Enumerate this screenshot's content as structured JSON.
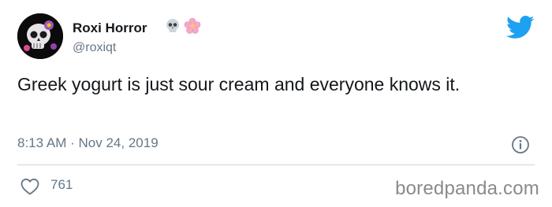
{
  "author": {
    "display_name": "Roxi Horror",
    "handle": "@roxiqt",
    "name_emojis": [
      "💀",
      "🌸"
    ]
  },
  "tweet": {
    "text": "Greek yogurt is just sour cream and everyone knows it.",
    "time": "8:13 AM",
    "separator": "·",
    "date": "Nov 24, 2019",
    "likes": "761"
  },
  "watermark": "boredpanda.com",
  "icons": {
    "platform": "twitter-bird-icon",
    "info": "info-icon",
    "like": "heart-icon"
  },
  "colors": {
    "brand": "#1da1f2",
    "secondary_text": "#657786",
    "primary_text": "#14171a",
    "divider": "#ccd6dd"
  }
}
